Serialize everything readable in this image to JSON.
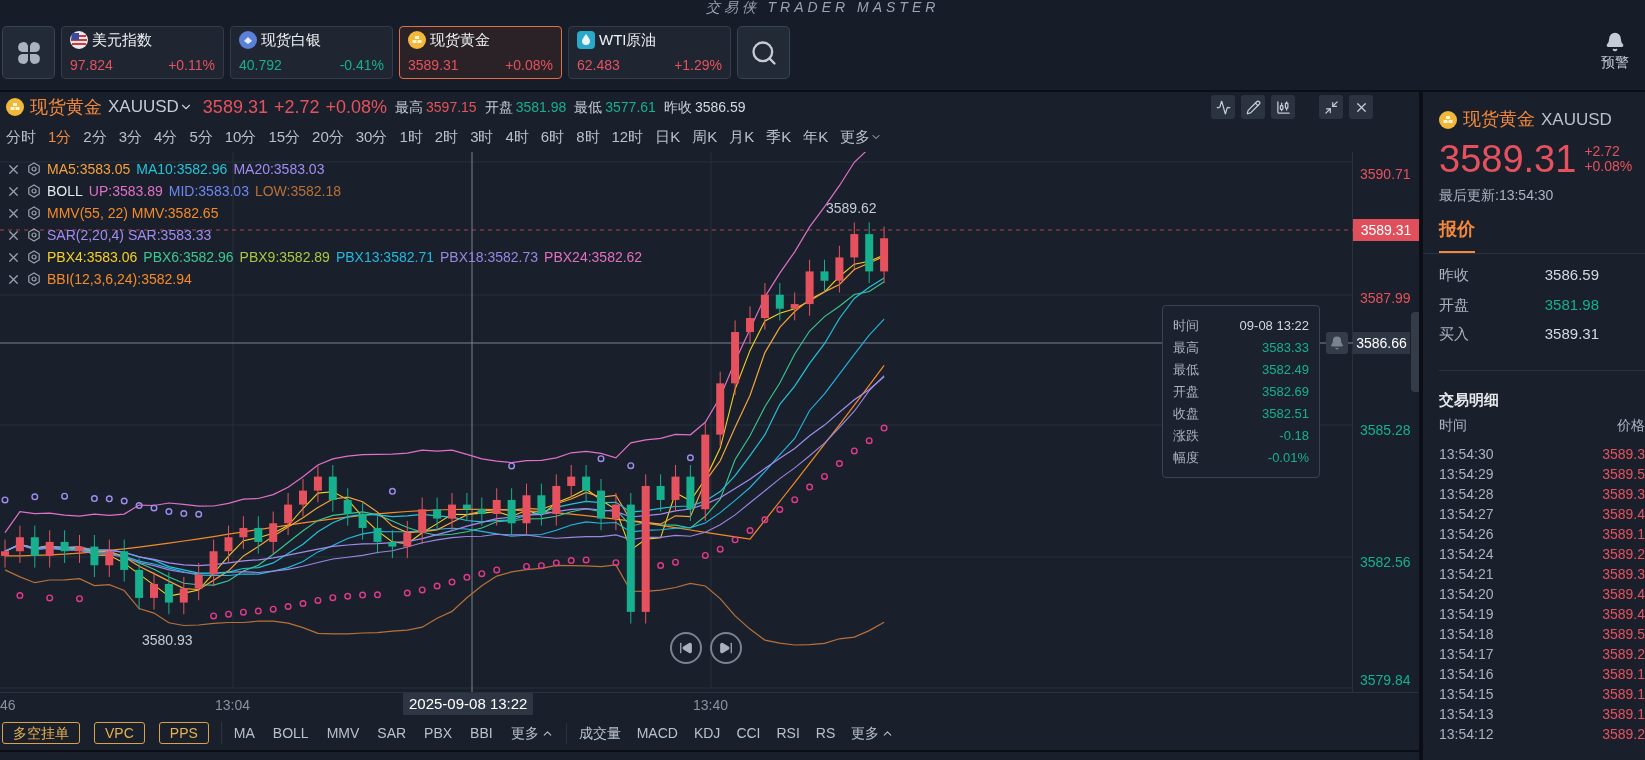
{
  "app_title": "交易侠 TRADER MASTER",
  "tickers": [
    {
      "kind": "flag",
      "name": "美元指数",
      "price": "97.824",
      "change": "+0.11%",
      "color": "#e5525e",
      "selected": false
    },
    {
      "kind": "silver",
      "name": "现货白银",
      "price": "40.792",
      "change": "-0.41%",
      "color": "#16b08e",
      "selected": false
    },
    {
      "kind": "gold",
      "name": "现货黄金",
      "price": "3589.31",
      "change": "+0.08%",
      "color": "#e5525e",
      "selected": true
    },
    {
      "kind": "oil",
      "name": "WTI原油",
      "price": "62.483",
      "change": "+1.29%",
      "color": "#e5525e",
      "selected": false
    }
  ],
  "alert_button": "预警",
  "chart_header": {
    "name": "现货黄金",
    "code": "XAUUSD",
    "price": "3589.31",
    "change": "+2.72",
    "percent": "+0.08%",
    "color": "#e5525e",
    "stats": [
      {
        "label": "最高",
        "value": "3597.15",
        "color": "#e5525e"
      },
      {
        "label": "开盘",
        "value": "3581.98",
        "color": "#16b08e"
      },
      {
        "label": "最低",
        "value": "3577.61",
        "color": "#16b08e"
      },
      {
        "label": "昨收",
        "value": "3586.59",
        "color": "#d5d9e0"
      }
    ]
  },
  "periods": [
    {
      "label": "分时",
      "selected": false
    },
    {
      "label": "1分",
      "selected": true
    },
    {
      "label": "2分",
      "selected": false
    },
    {
      "label": "3分",
      "selected": false
    },
    {
      "label": "4分",
      "selected": false
    },
    {
      "label": "5分",
      "selected": false
    },
    {
      "label": "10分",
      "selected": false
    },
    {
      "label": "15分",
      "selected": false
    },
    {
      "label": "20分",
      "selected": false
    },
    {
      "label": "30分",
      "selected": false
    },
    {
      "label": "1时",
      "selected": false
    },
    {
      "label": "2时",
      "selected": false
    },
    {
      "label": "3时",
      "selected": false
    },
    {
      "label": "4时",
      "selected": false
    },
    {
      "label": "6时",
      "selected": false
    },
    {
      "label": "8时",
      "selected": false
    },
    {
      "label": "12时",
      "selected": false
    },
    {
      "label": "日K",
      "selected": false
    },
    {
      "label": "周K",
      "selected": false
    },
    {
      "label": "月K",
      "selected": false
    },
    {
      "label": "季K",
      "selected": false
    },
    {
      "label": "年K",
      "selected": false
    },
    {
      "label": "更多",
      "selected": false
    }
  ],
  "indicators": [
    {
      "segments": [
        {
          "text": "MA5:3583.05",
          "color": "#f5a23c"
        },
        {
          "text": "MA10:3582.96",
          "color": "#22c3d8"
        },
        {
          "text": "MA20:3583.03",
          "color": "#a18cf0"
        }
      ]
    },
    {
      "segments": [
        {
          "text": "BOLL",
          "color": "#e6e8ec"
        },
        {
          "text": "UP:3583.89",
          "color": "#e070c8"
        },
        {
          "text": "MID:3583.03",
          "color": "#6f86f0"
        },
        {
          "text": "LOW:3582.18",
          "color": "#b8703a"
        }
      ]
    },
    {
      "segments": [
        {
          "text": "MMV(55, 22) MMV:3582.65",
          "color": "#f58a28"
        }
      ]
    },
    {
      "segments": [
        {
          "text": "SAR(2,20,4) SAR:3583.33",
          "color": "#a18cf0"
        }
      ]
    },
    {
      "segments": [
        {
          "text": "PBX4:3583.06",
          "color": "#f5d020"
        },
        {
          "text": "PBX6:3582.96",
          "color": "#3cc890"
        },
        {
          "text": "PBX9:3582.89",
          "color": "#a8c840"
        },
        {
          "text": "PBX13:3582.71",
          "color": "#22b8e0"
        },
        {
          "text": "PBX18:3582.73",
          "color": "#9a86e0"
        },
        {
          "text": "PBX24:3582.62",
          "color": "#e070c0"
        }
      ]
    },
    {
      "segments": [
        {
          "text": "BBI(12,3,6,24):3582.94",
          "color": "#f58a28"
        }
      ]
    }
  ],
  "price_axis": [
    {
      "label": "3590.71",
      "color": "#e5525e"
    },
    {
      "label": "3587.99",
      "color": "#e5525e"
    },
    {
      "label": "3585.28",
      "color": "#16b08e"
    },
    {
      "label": "3582.56",
      "color": "#16b08e"
    },
    {
      "label": "3579.84",
      "color": "#16b08e"
    }
  ],
  "current_price_tag": "3589.31",
  "crosshair": {
    "price": "3586.66",
    "time": "2025-09-08 13:22"
  },
  "high_marker": "3589.62",
  "low_marker": "3580.93",
  "tooltip": [
    {
      "label": "时间",
      "value": "09-08 13:22",
      "color": "#d5d9e0"
    },
    {
      "label": "最高",
      "value": "3583.33",
      "color": "#16b08e"
    },
    {
      "label": "最低",
      "value": "3582.49",
      "color": "#16b08e"
    },
    {
      "label": "开盘",
      "value": "3582.69",
      "color": "#16b08e"
    },
    {
      "label": "收盘",
      "value": "3582.51",
      "color": "#16b08e"
    },
    {
      "label": "涨跌",
      "value": "-0.18",
      "color": "#16b08e"
    },
    {
      "label": "幅度",
      "value": "-0.01%",
      "color": "#16b08e"
    }
  ],
  "time_axis": [
    "46",
    "13:04",
    "13:40"
  ],
  "bottom_toolbar": {
    "buttons": [
      "多空挂单",
      "VPC",
      "PPS"
    ],
    "main_indicators": [
      "MA",
      "BOLL",
      "MMV",
      "SAR",
      "PBX",
      "BBI",
      "更多"
    ],
    "sub_indicators": [
      "成交量",
      "MACD",
      "KDJ",
      "CCI",
      "RSI",
      "RS",
      "更多"
    ]
  },
  "side_panel": {
    "name": "现货黄金",
    "code": "XAUUSD",
    "price": "3589.31",
    "change": "+2.72",
    "percent": "+0.08%",
    "color": "#e5525e",
    "updated": "最后更新:13:54:30",
    "tabs": [
      {
        "label": "报价",
        "selected": true
      }
    ],
    "quotes": [
      {
        "label": "昨收",
        "value": "3586.59",
        "color": "#d5d9e0"
      },
      {
        "label": "开盘",
        "value": "3581.98",
        "color": "#16b08e"
      },
      {
        "label": "买入",
        "value": "3589.31",
        "color": "#d5d9e0"
      }
    ],
    "trades_title": "交易明细",
    "trade_columns": [
      "时间",
      "价格"
    ],
    "trades": [
      {
        "time": "13:54:30",
        "price": "3589.3"
      },
      {
        "time": "13:54:29",
        "price": "3589.5"
      },
      {
        "time": "13:54:28",
        "price": "3589.3"
      },
      {
        "time": "13:54:27",
        "price": "3589.4"
      },
      {
        "time": "13:54:26",
        "price": "3589.1"
      },
      {
        "time": "13:54:24",
        "price": "3589.2"
      },
      {
        "time": "13:54:21",
        "price": "3589.3"
      },
      {
        "time": "13:54:20",
        "price": "3589.4"
      },
      {
        "time": "13:54:19",
        "price": "3589.4"
      },
      {
        "time": "13:54:18",
        "price": "3589.5"
      },
      {
        "time": "13:54:17",
        "price": "3589.2"
      },
      {
        "time": "13:54:16",
        "price": "3589.1"
      },
      {
        "time": "13:54:15",
        "price": "3589.1"
      },
      {
        "time": "13:54:13",
        "price": "3589.1"
      },
      {
        "time": "13:54:12",
        "price": "3589.2"
      }
    ]
  }
}
